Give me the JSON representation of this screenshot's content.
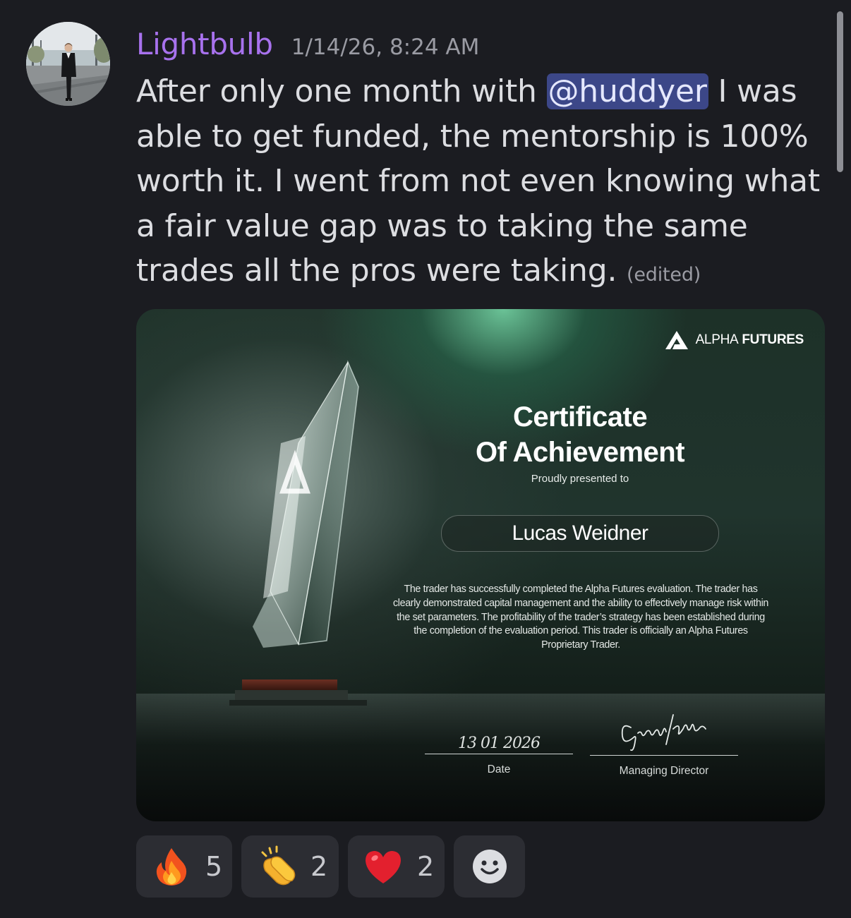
{
  "message": {
    "username": "Lightbulb",
    "timestamp": "1/14/26, 8:24 AM",
    "text_before_mention": "After only one month with ",
    "mention": "@huddyer",
    "text_after_mention": " I was able to get funded, the mentorship is 100% worth it. I went from not even knowing what a fair value gap was to taking the same trades all the pros were taking. ",
    "edited_label": "(edited)"
  },
  "certificate": {
    "brand_alpha": "ALPHA",
    "brand_futures": "FUTURES",
    "title_line1": "Certificate",
    "title_line2": "Of Achievement",
    "presented_label": "Proudly presented to",
    "recipient": "Lucas Weidner",
    "body": "The trader has successfully completed the Alpha Futures evaluation. The trader has clearly demonstrated capital management and the ability to effectively manage risk within the set parameters. The profitability of the trader’s strategy has been established during the completion of the evaluation period. This trader is officially an Alpha Futures Proprietary Trader.",
    "date_value": "13 01 2026",
    "date_label": "Date",
    "signer_label": "Managing Director",
    "signature": "George Kohler"
  },
  "reactions": [
    {
      "emoji": "fire-emoji",
      "count": "5"
    },
    {
      "emoji": "clapping-hands-emoji",
      "count": "2"
    },
    {
      "emoji": "red-heart-emoji",
      "count": "2"
    }
  ],
  "add_reaction_icon": "add-reaction-icon",
  "colors": {
    "background": "#1b1c21",
    "username": "#a872ee",
    "mention_bg": "#3c4788",
    "reaction_bg": "#2c2d33"
  }
}
